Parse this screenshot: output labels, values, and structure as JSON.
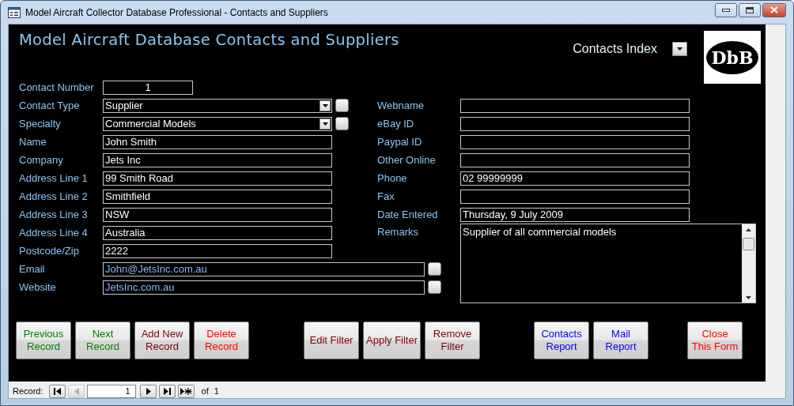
{
  "window": {
    "title": "Model Aircraft Collector Database Professional - Contacts and Suppliers"
  },
  "header": {
    "heading": "Model Aircraft Database Contacts and Suppliers",
    "index_label": "Contacts Index",
    "logo": "DbB"
  },
  "left_fields": [
    {
      "label": "Contact Number",
      "kind": "number",
      "value": "1"
    },
    {
      "label": "Contact Type",
      "kind": "combo",
      "value": "Supplier"
    },
    {
      "label": "Specialty",
      "kind": "combo",
      "value": "Commercial Models"
    },
    {
      "label": "Name",
      "kind": "text",
      "value": "John Smith"
    },
    {
      "label": "Company",
      "kind": "text",
      "value": "Jets Inc"
    },
    {
      "label": "Address Line 1",
      "kind": "text",
      "value": "99 Smith Road"
    },
    {
      "label": "Address Line 2",
      "kind": "text",
      "value": "Smithfield"
    },
    {
      "label": "Address Line 3",
      "kind": "text",
      "value": "NSW"
    },
    {
      "label": "Address Line 4",
      "kind": "text",
      "value": "Australia"
    },
    {
      "label": "Postcode/Zip",
      "kind": "text",
      "value": "2222"
    },
    {
      "label": "Email",
      "kind": "link",
      "value": "John@JetsInc.com.au"
    },
    {
      "label": "Website",
      "kind": "link",
      "value": "JetsInc.com.au"
    }
  ],
  "right_fields": [
    {
      "label": "Webname",
      "kind": "text"
    },
    {
      "label": "eBay ID",
      "kind": "text"
    },
    {
      "label": "Paypal ID",
      "kind": "text"
    },
    {
      "label": "Other Online",
      "kind": "text"
    },
    {
      "label": "Phone",
      "kind": "text",
      "value": "02 99999999"
    },
    {
      "label": "Fax",
      "kind": "text"
    },
    {
      "label": "Date Entered",
      "kind": "text",
      "value": "Thursday, 9 July 2009"
    }
  ],
  "remarks": {
    "label": "Remarks",
    "value": "Supplier of all commercial models"
  },
  "button_groups": [
    [
      {
        "label": "Previous\nRecord",
        "color": "#008000"
      },
      {
        "label": "Next\nRecord",
        "color": "#008000"
      },
      {
        "label": "Add New\nRecord",
        "color": "#800000"
      },
      {
        "label": "Delete\nRecord",
        "color": "#ff0000"
      }
    ],
    [
      {
        "label": "Edit Filter",
        "color": "#800000"
      },
      {
        "label": "Apply Filter",
        "color": "#800000"
      },
      {
        "label": "Remove\nFilter",
        "color": "#800000"
      }
    ],
    [
      {
        "label": "Contacts\nReport",
        "color": "#0000ff"
      },
      {
        "label": "Mail\nReport",
        "color": "#0000ff"
      }
    ],
    [
      {
        "label": "Close\nThis Form",
        "color": "#ff0000"
      }
    ]
  ],
  "record_nav": {
    "label": "Record:",
    "current": "1",
    "of": "of",
    "total": "1",
    "buttons": [
      {
        "kind": "first",
        "disabled": false
      },
      {
        "kind": "previous",
        "disabled": true
      },
      {
        "kind": "next",
        "disabled": false
      },
      {
        "kind": "last",
        "disabled": false
      },
      {
        "kind": "new",
        "disabled": false
      }
    ]
  }
}
